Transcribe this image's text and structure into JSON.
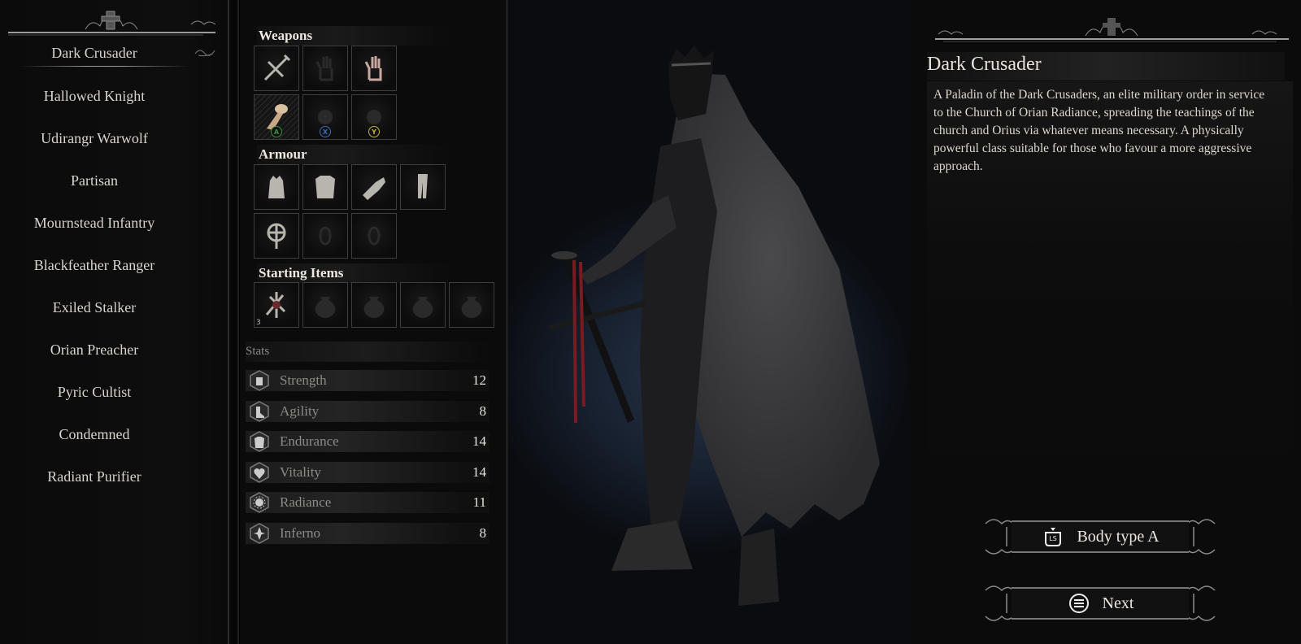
{
  "class_list": {
    "selected_index": 0,
    "items": [
      "Dark Crusader",
      "Hallowed Knight",
      "Udirangr Warwolf",
      "Partisan",
      "Mournstead Infantry",
      "Blackfeather Ranger",
      "Exiled Stalker",
      "Orian Preacher",
      "Pyric Cultist",
      "Condemned",
      "Radiant Purifier"
    ]
  },
  "equipment": {
    "weapons_label": "Weapons",
    "weapons": [
      {
        "icon": "crossbow-icon",
        "state": "filled"
      },
      {
        "icon": "empty-hand-icon",
        "state": "empty"
      },
      {
        "icon": "hand-icon",
        "state": "filled"
      },
      {
        "icon": "lamp-icon",
        "state": "filled",
        "button": "A",
        "button_color": "#3d8a3f"
      },
      {
        "icon": "empty-slot-icon",
        "state": "empty",
        "button": "X",
        "button_color": "#3a6fae"
      },
      {
        "icon": "empty-slot-icon",
        "state": "empty",
        "button": "Y",
        "button_color": "#c8b23a"
      }
    ],
    "armour_label": "Armour",
    "armour": [
      {
        "icon": "helmet-icon",
        "state": "filled"
      },
      {
        "icon": "chest-armour-icon",
        "state": "filled"
      },
      {
        "icon": "gauntlet-icon",
        "state": "filled"
      },
      {
        "icon": "leggings-icon",
        "state": "filled"
      },
      {
        "icon": "amulet-icon",
        "state": "filled"
      },
      {
        "icon": "ring-icon",
        "state": "empty"
      },
      {
        "icon": "ring-icon",
        "state": "empty"
      }
    ],
    "starting_items_label": "Starting Items",
    "starting_items": [
      {
        "icon": "relic-icon",
        "state": "filled",
        "qty": "3"
      },
      {
        "icon": "pouch-icon",
        "state": "empty"
      },
      {
        "icon": "pouch-icon",
        "state": "empty"
      },
      {
        "icon": "pouch-icon",
        "state": "empty"
      },
      {
        "icon": "pouch-icon",
        "state": "empty"
      }
    ]
  },
  "stats": {
    "label": "Stats",
    "items": [
      {
        "name": "Strength",
        "value": "12",
        "icon": "fist-icon"
      },
      {
        "name": "Agility",
        "value": "8",
        "icon": "boot-icon"
      },
      {
        "name": "Endurance",
        "value": "14",
        "icon": "armour-icon"
      },
      {
        "name": "Vitality",
        "value": "14",
        "icon": "heart-icon"
      },
      {
        "name": "Radiance",
        "value": "11",
        "icon": "sun-icon"
      },
      {
        "name": "Inferno",
        "value": "8",
        "icon": "flame-icon"
      }
    ]
  },
  "description": {
    "title": "Dark Crusader",
    "text": "A Paladin of the Dark Crusaders, an elite military order in service to the Church of Orian Radiance, spreading the teachings of the church and Orius via whatever means necessary. A physically powerful class suitable for those who favour a more aggressive approach."
  },
  "actions": {
    "body_type": {
      "label": "Body type A",
      "button_glyph": "LS"
    },
    "next": {
      "label": "Next"
    }
  }
}
